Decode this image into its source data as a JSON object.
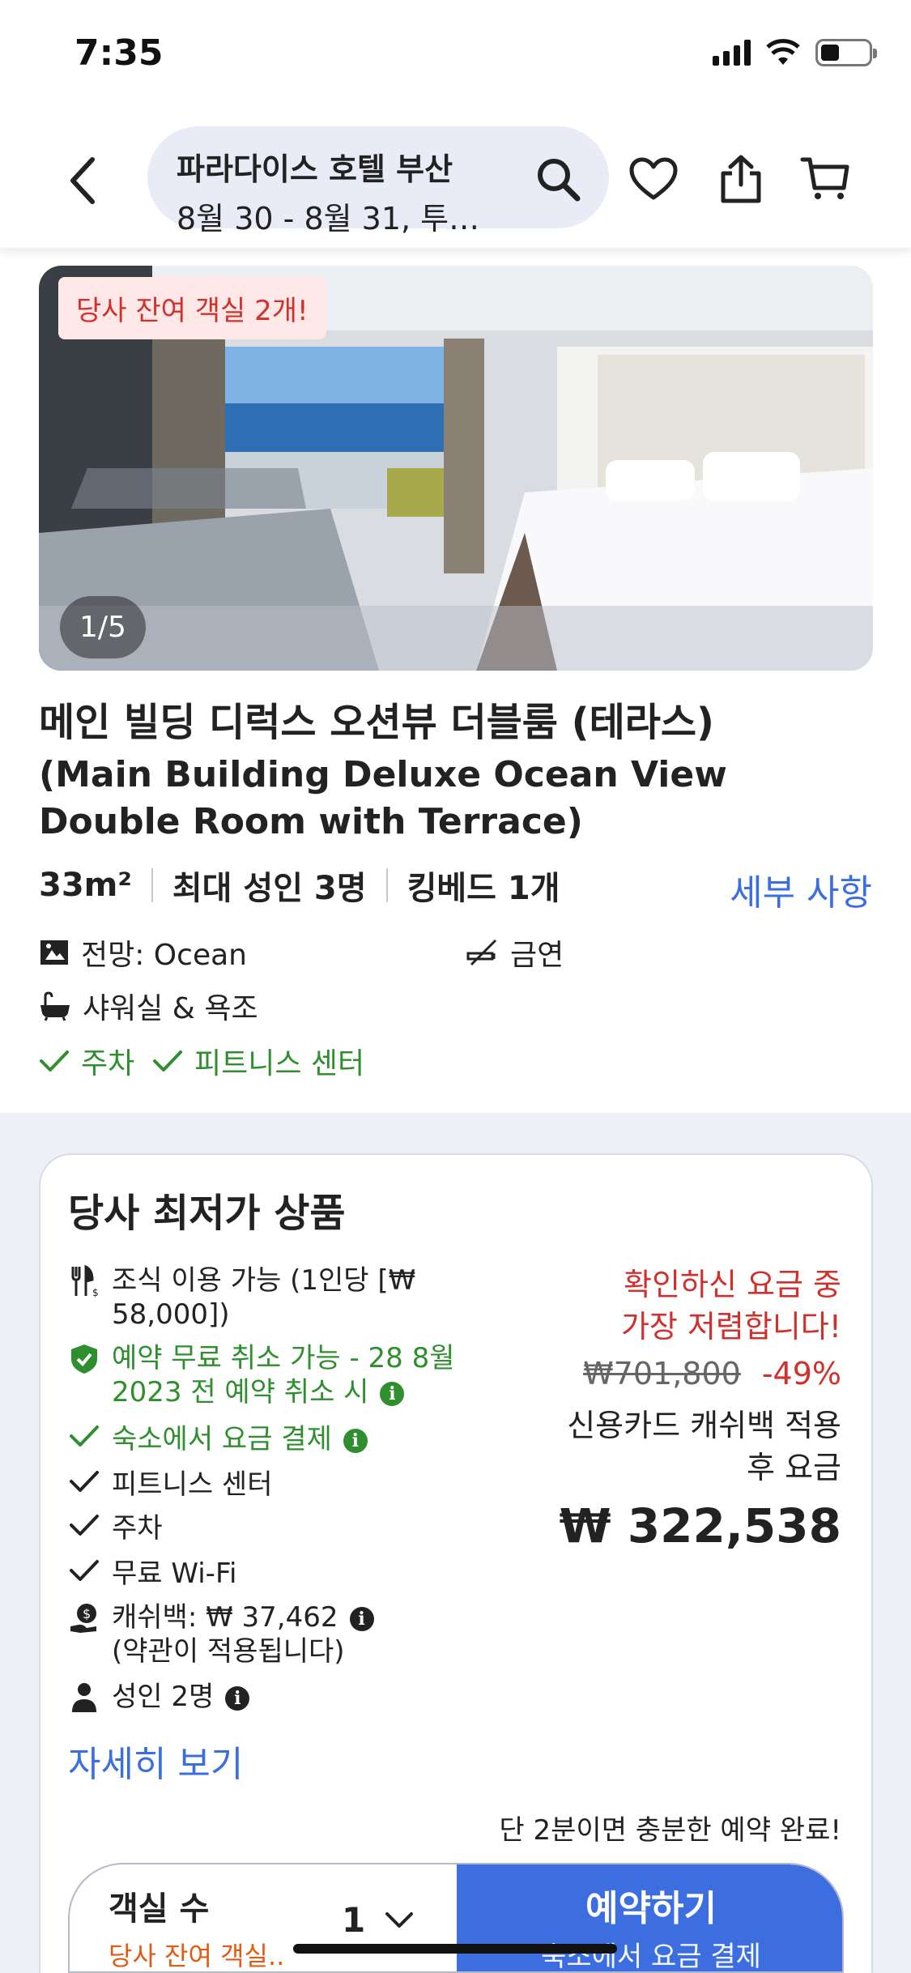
{
  "status": {
    "time": "7:35"
  },
  "header": {
    "search_title": "파라다이스 호텔 부산",
    "search_sub": "8월 30 - 8월 31, 투…"
  },
  "photo": {
    "badge": "당사 잔여 객실 2개!",
    "counter": "1/5"
  },
  "room": {
    "title_ko": "메인 빌딩 디럭스 오션뷰 더블룸 (테라스)",
    "title_en": "(Main Building Deluxe Ocean View Double Room with Terrace)",
    "facts": [
      "33m²",
      "최대 성인 3명",
      "킹베드 1개"
    ],
    "details_link": "세부 사항",
    "view": "전망: Ocean",
    "smoking": "금연",
    "bath": "샤워실 & 욕조",
    "parking": "주차",
    "fitness": "피트니스 센터"
  },
  "deal": {
    "title": "당사 최저가 상품",
    "features": {
      "breakfast": "조식 이용 가능 (1인당 [₩ 58,000])",
      "free_cancel": "예약 무료 취소 가능 - 28 8월 2023 전 예약 취소 시",
      "pay_at_property": "숙소에서 요금 결제",
      "fitness": "피트니스 센터",
      "parking": "주차",
      "wifi": "무료 Wi-Fi",
      "cashback": "캐쉬백: ₩ 37,462",
      "cashback_terms": "(약관이 적용됩니다)",
      "adults": "성인 2명"
    },
    "more_link": "자세히 보기",
    "price_note_line1": "확인하신 요금 중",
    "price_note_line2": "가장 저렴합니다!",
    "original_price": "₩701,800",
    "discount": "-49%",
    "cashback_note_line1": "신용카드 캐쉬백 적용",
    "cashback_note_line2": "후 요금",
    "final_price": "₩ 322,538",
    "quick_note": "단 2분이면 충분한 예약 완료!"
  },
  "booking": {
    "rooms_label": "객실 수",
    "rooms_note": "당사 잔여 객실..",
    "rooms_value": "1",
    "book_label": "예약하기",
    "book_sub": "숙소에서 요금 결제"
  },
  "colors": {
    "accent_blue": "#3d6ee0",
    "link_blue": "#3b6ee0",
    "alert_red": "#d0312d",
    "success_green": "#2f8f2f",
    "section_bg": "#eef0f8"
  },
  "icons": [
    "back-icon",
    "search-icon",
    "heart-icon",
    "share-icon",
    "cart-icon",
    "view-icon",
    "no-smoking-icon",
    "bathtub-icon",
    "check-icon",
    "utensils-icon",
    "shield-check-icon",
    "cashback-icon",
    "person-icon",
    "info-icon",
    "chevron-down-icon"
  ]
}
